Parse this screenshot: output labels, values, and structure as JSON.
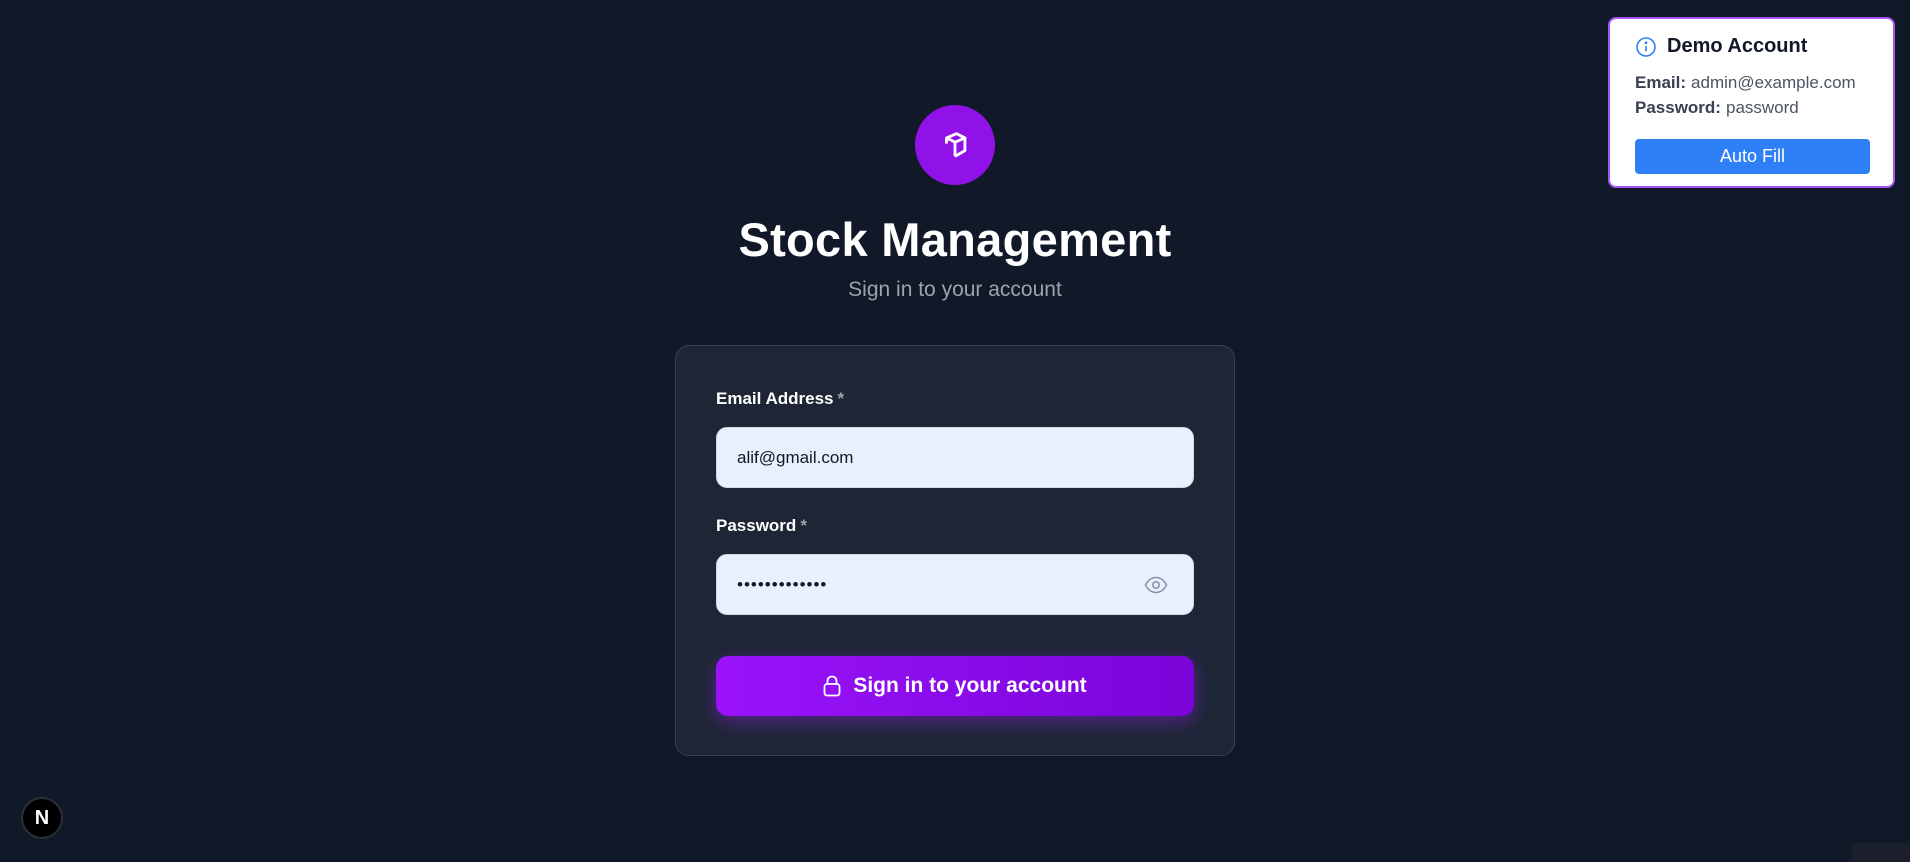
{
  "brand": {
    "icon": "package-icon",
    "title": "Stock Management",
    "subtitle": "Sign in to your account"
  },
  "form": {
    "email": {
      "label": "Email Address",
      "required_mark": "*",
      "value": "alif@gmail.com"
    },
    "password": {
      "label": "Password",
      "required_mark": "*",
      "value": "alif@gmail.co",
      "toggle_icon": "eye-icon"
    },
    "submit": {
      "icon": "lock-icon",
      "label": "Sign in to your account"
    }
  },
  "demo_account": {
    "icon": "info-icon",
    "title": "Demo Account",
    "email_key": "Email:",
    "email_value": "admin@example.com",
    "password_key": "Password:",
    "password_value": "password",
    "autofill_label": "Auto Fill"
  },
  "dev_badge": {
    "label": "N"
  },
  "colors": {
    "background": "#111827",
    "card": "#1e2636",
    "accent": "#9012e8",
    "autofill": "#2f80f6"
  }
}
